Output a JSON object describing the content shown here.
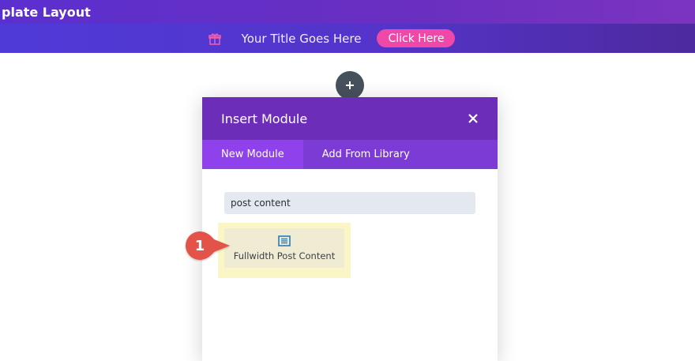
{
  "topbar": {
    "title": "plate Layout"
  },
  "banner": {
    "title": "Your Title Goes Here",
    "button_label": "Click Here"
  },
  "modal": {
    "title": "Insert Module",
    "tabs": [
      {
        "label": "New Module",
        "active": true
      },
      {
        "label": "Add From Library",
        "active": false
      }
    ],
    "search_value": "post content",
    "result": {
      "label": "Fullwidth Post Content"
    }
  },
  "callout": {
    "number": "1"
  },
  "colors": {
    "header": "#6c2eb9",
    "tabs": "#7d3bd6",
    "active_tab": "#8f42ec",
    "cta": "#ef48a8",
    "callout": "#e4524a"
  },
  "icons": [
    "gift-icon",
    "plus-icon",
    "close-icon",
    "post-content-icon"
  ]
}
